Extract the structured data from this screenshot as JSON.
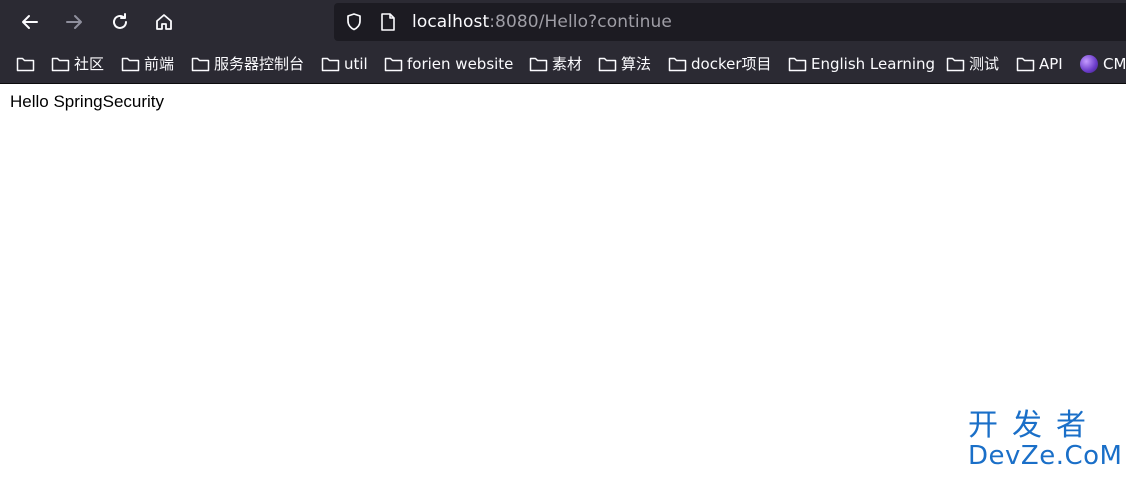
{
  "browser": {
    "url_host": "localhost",
    "url_rest": ":8080/Hello?continue",
    "bookmarks": [
      {
        "label": ""
      },
      {
        "label": "社区"
      },
      {
        "label": "前端"
      },
      {
        "label": "服务器控制台"
      },
      {
        "label": "util"
      },
      {
        "label": "forien website"
      },
      {
        "label": "素材"
      },
      {
        "label": "算法"
      },
      {
        "label": "docker项目"
      },
      {
        "label": "English Learning"
      },
      {
        "label": "测试"
      },
      {
        "label": "API"
      },
      {
        "label": "CM"
      }
    ]
  },
  "page": {
    "text": "Hello SpringSecurity"
  },
  "watermark": {
    "cn": "开发者",
    "en": "DevZe.CoM"
  },
  "colors": {
    "toolbar_bg": "#2b2a33",
    "urlbar_bg": "#1c1b22",
    "watermark": "#1a6fc8"
  }
}
